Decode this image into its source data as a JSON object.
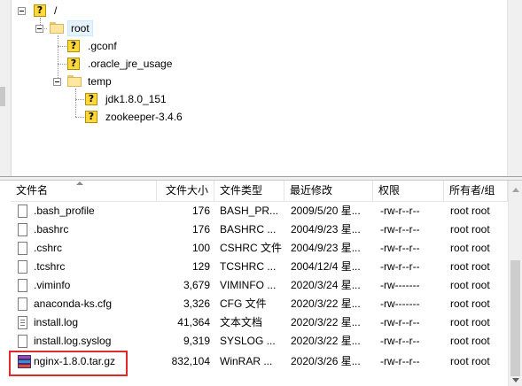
{
  "tree": {
    "root_slash": "/",
    "root": "root",
    "children": [
      {
        "label": ".gconf"
      },
      {
        "label": ".oracle_jre_usage"
      },
      {
        "label": "temp"
      }
    ],
    "temp_children": [
      {
        "label": "jdk1.8.0_151"
      },
      {
        "label": "zookeeper-3.4.6"
      }
    ]
  },
  "columns": {
    "name": "文件名",
    "size": "文件大小",
    "type": "文件类型",
    "modified": "最近修改",
    "permissions": "权限",
    "owner": "所有者/组"
  },
  "files": [
    {
      "name": ".bash_profile",
      "size": "176",
      "type": "BASH_PR...",
      "modified": "2009/5/20 星...",
      "permissions": "-rw-r--r--",
      "owner": "root root",
      "icon": "document-icon"
    },
    {
      "name": ".bashrc",
      "size": "176",
      "type": "BASHRC ...",
      "modified": "2004/9/23 星...",
      "permissions": "-rw-r--r--",
      "owner": "root root",
      "icon": "document-icon"
    },
    {
      "name": ".cshrc",
      "size": "100",
      "type": "CSHRC 文件",
      "modified": "2004/9/23 星...",
      "permissions": "-rw-r--r--",
      "owner": "root root",
      "icon": "document-icon"
    },
    {
      "name": ".tcshrc",
      "size": "129",
      "type": "TCSHRC ...",
      "modified": "2004/12/4 星...",
      "permissions": "-rw-r--r--",
      "owner": "root root",
      "icon": "document-icon"
    },
    {
      "name": ".viminfo",
      "size": "3,679",
      "type": "VIMINFO ...",
      "modified": "2020/3/24 星...",
      "permissions": "-rw-------",
      "owner": "root root",
      "icon": "document-icon"
    },
    {
      "name": "anaconda-ks.cfg",
      "size": "3,326",
      "type": "CFG 文件",
      "modified": "2020/3/22 星...",
      "permissions": "-rw-------",
      "owner": "root root",
      "icon": "document-icon"
    },
    {
      "name": "install.log",
      "size": "41,364",
      "type": "文本文档",
      "modified": "2020/3/22 星...",
      "permissions": "-rw-r--r--",
      "owner": "root root",
      "icon": "text-document-icon"
    },
    {
      "name": "install.log.syslog",
      "size": "9,319",
      "type": "SYSLOG ...",
      "modified": "2020/3/22 星...",
      "permissions": "-rw-r--r--",
      "owner": "root root",
      "icon": "document-icon"
    },
    {
      "name": "nginx-1.8.0.tar.gz",
      "size": "832,104",
      "type": "WinRAR ...",
      "modified": "2020/3/26 星...",
      "permissions": "-rw-r--r--",
      "owner": "root root",
      "icon": "winrar-archive-icon"
    }
  ],
  "colors": {
    "highlight_box": "#e02a2a",
    "selection": "#e5f3ff"
  }
}
